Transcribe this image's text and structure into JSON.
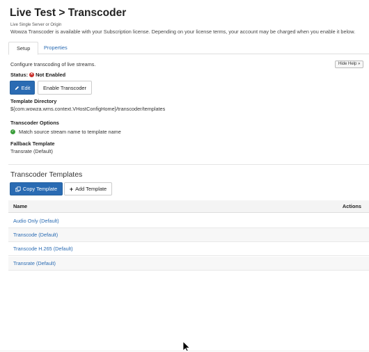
{
  "header": {
    "title": "Live Test > Transcoder",
    "subtitle": "Live Single Server or Origin",
    "license_note": "Wowza Transcoder is available with your Subscription license. Depending on your license terms, your account may be charged when you enable it below."
  },
  "tabs": [
    {
      "label": "Setup",
      "active": true
    },
    {
      "label": "Properties",
      "active": false
    }
  ],
  "setup": {
    "configure_text": "Configure transcoding of live streams.",
    "hide_help_label": "Hide Help »",
    "status_label": "Status:",
    "status_value": "Not Enabled",
    "edit_label": "Edit",
    "enable_label": "Enable Transcoder",
    "template_directory_label": "Template Directory",
    "template_directory_value": "${com.wowza.wms.context.VHostConfigHome}/transcoder/templates",
    "transcoder_options_label": "Transcoder Options",
    "option_match": "Match source stream name to template name",
    "fallback_label": "Fallback Template",
    "fallback_value": "Transrate (Default)"
  },
  "templates": {
    "heading": "Transcoder Templates",
    "copy_label": "Copy Template",
    "add_label": "Add Template",
    "columns": {
      "name": "Name",
      "actions": "Actions"
    },
    "rows": [
      "Audio Only (Default)",
      "Transcode (Default)",
      "Transcode H.265 (Default)",
      "Transrate (Default)"
    ]
  },
  "colors": {
    "primary": "#2a6bb3",
    "link": "#2a6bb3",
    "status_error": "#c9302c",
    "status_ok": "#3a9d3a"
  },
  "icons": {
    "status": "x-circle-icon",
    "edit": "pencil-icon",
    "copy": "copy-icon",
    "add": "plus-icon",
    "option": "check-circle-icon"
  }
}
